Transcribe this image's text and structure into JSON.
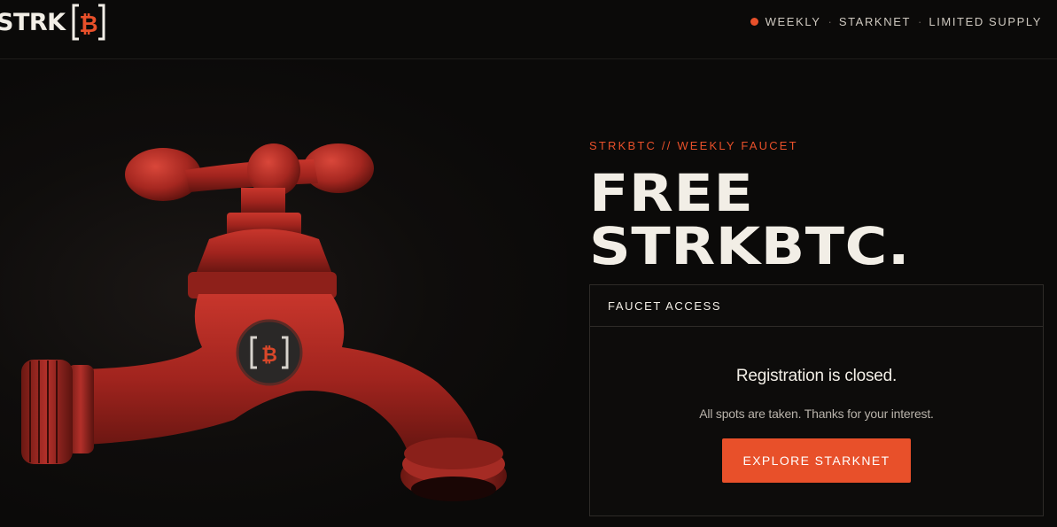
{
  "header": {
    "logo_text": "STRK",
    "nav": [
      "WEEKLY",
      "STARKNET",
      "LIMITED SUPPLY"
    ],
    "separator": "·"
  },
  "hero": {
    "eyebrow": "STRKBTC // WEEKLY FAUCET",
    "headline_line1": "FREE",
    "headline_line2": "STRKBTC."
  },
  "card": {
    "header": "FAUCET ACCESS",
    "title": "Registration is closed.",
    "subtitle": "All spots are taken. Thanks for your interest.",
    "button_label": "EXPLORE STARKNET"
  },
  "colors": {
    "accent": "#e8502a",
    "background": "#0b0a09",
    "text": "#f2eee6"
  },
  "icons": [
    "bitcoin-bracket-logo-icon",
    "status-dot-icon",
    "faucet-image"
  ]
}
